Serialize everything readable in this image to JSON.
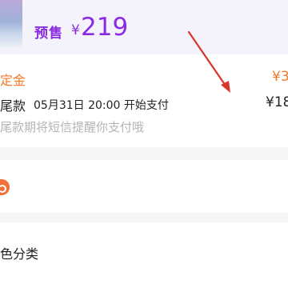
{
  "header": {
    "presale_label": "预售",
    "price_currency": "¥",
    "price_value": "219"
  },
  "payment": {
    "deposit_label": "定金",
    "deposit_amount": "¥3",
    "final_label": "尾款",
    "final_time": "05月31日 20:00 开始支付",
    "final_amount": "¥18",
    "sms_note": "尾款期将短信提醒你支付哦"
  },
  "options": {
    "color_category_label": "色分类"
  },
  "colors": {
    "presale_purple": "#8a2be2",
    "deposit_orange": "#f07a2a",
    "annotation_red": "#d9362b"
  },
  "icons": {
    "orange_circle": "orange-circle-icon",
    "arrow": "red-arrow-annotation"
  }
}
